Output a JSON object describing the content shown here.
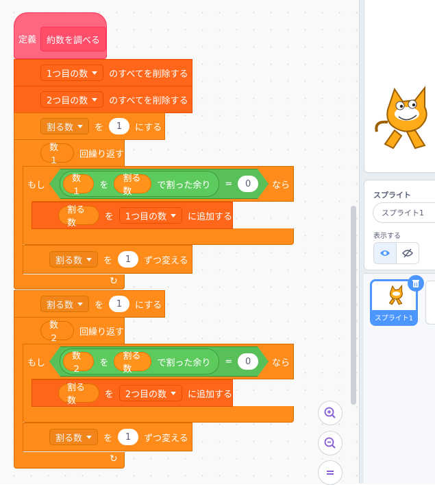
{
  "define": {
    "keyword": "定義",
    "name": "約数を調べる"
  },
  "delete1": {
    "list": "1つ目の数",
    "text": "のすべてを削除する"
  },
  "delete2": {
    "list": "2つ目の数",
    "text": "のすべてを削除する"
  },
  "set1": {
    "var": "割る数",
    "to": "を",
    "value": "1",
    "text": "にする"
  },
  "repeat1": {
    "count": "数１",
    "text": "回繰り返す"
  },
  "if1": {
    "if": "もし",
    "dividend": "数１",
    "wo": "を",
    "divisor": "割る数",
    "mod": "で割った余り",
    "eq": "=",
    "value": "0",
    "then": "なら"
  },
  "add1": {
    "item": "割る数",
    "wo": "を",
    "list": "1つ目の数",
    "text": "に追加する"
  },
  "change1": {
    "var": "割る数",
    "wo": "を",
    "value": "1",
    "text": "ずつ変える"
  },
  "set2": {
    "var": "割る数",
    "to": "を",
    "value": "1",
    "text": "にする"
  },
  "repeat2": {
    "count": "数２",
    "text": "回繰り返す"
  },
  "if2": {
    "if": "もし",
    "dividend": "数２",
    "wo": "を",
    "divisor": "割る数",
    "mod": "で割った余り",
    "eq": "=",
    "value": "0",
    "then": "なら"
  },
  "add2": {
    "item": "割る数",
    "wo": "を",
    "list": "2つ目の数",
    "text": "に追加する"
  },
  "change2": {
    "var": "割る数",
    "wo": "を",
    "value": "1",
    "text": "ずつ変える"
  },
  "sprite_panel": {
    "label": "スプライト",
    "name_value": "スプライト1",
    "show_label": "表示する",
    "thumb_label": "スプライト1"
  },
  "zoom": {
    "in": "zoom-in-icon",
    "out": "zoom-out-icon",
    "reset": "zoom-reset-icon"
  }
}
